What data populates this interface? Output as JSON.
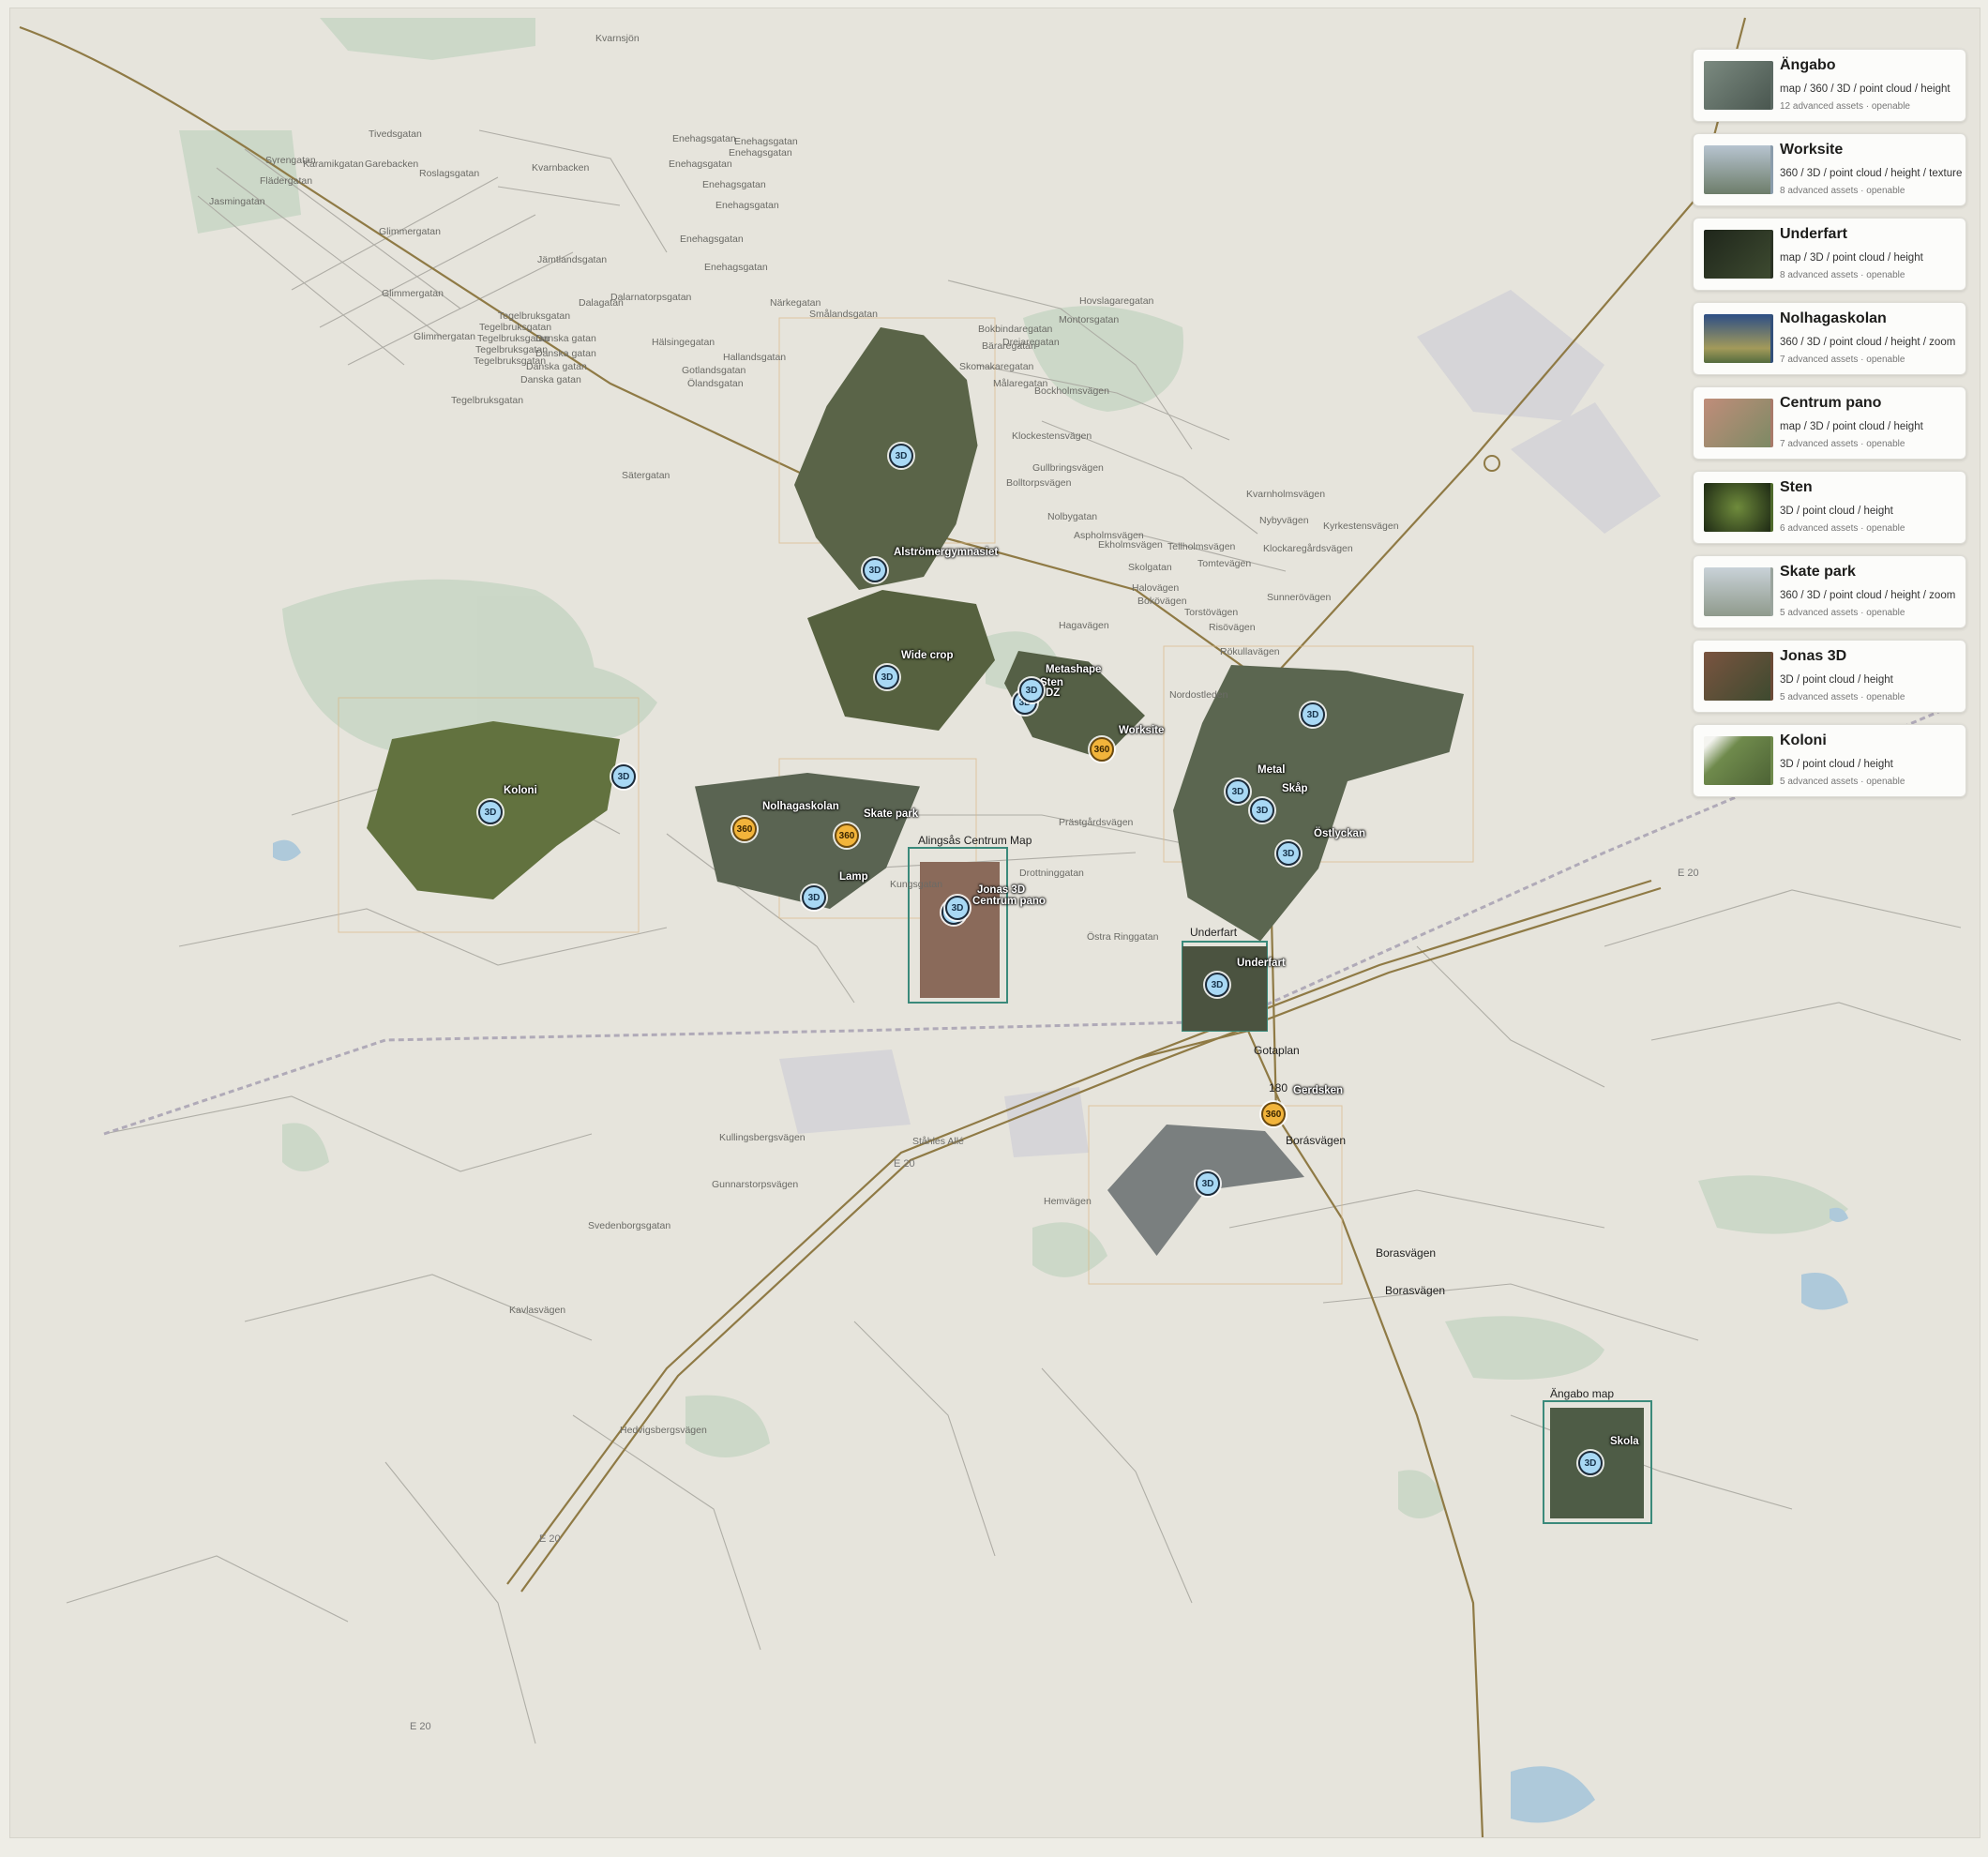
{
  "map": {
    "place_labels": [
      "Kvarnsjön",
      "Tivedsgatan",
      "Syrengatan",
      "Karamikgatan",
      "Garebacken",
      "Flädergatan",
      "Jasmingatan",
      "Glimmergatan",
      "Roslagsgatan",
      "Kvarnbacken",
      "Enehagsgatan",
      "Enehagsgatan",
      "Enehagsgatan",
      "Enehagsgatan",
      "Enehagsgatan",
      "Enehagsgatan",
      "Enehagsgatan",
      "Enehagsgatan",
      "Jämtlandsgatan",
      "Dalagatan",
      "Dalarnatorpsgatan",
      "Närkegatan",
      "Smålandsgatan",
      "Hallandsgatan",
      "Gotlandsgatan",
      "Ölandsgatan",
      "Hälsingegatan",
      "Tegelbruksgatan",
      "Tegelbruksgatan",
      "Tegelbruksgatan",
      "Tegelbruksgatan",
      "Tegelbruksgatan",
      "Tegelbruksgatan",
      "Danska gatan",
      "Danska gatan",
      "Danska gatan",
      "Danska gatan",
      "Glimmergatan",
      "Glimmergatan",
      "Sätergatan",
      "Hovslagaregatan",
      "Montorsgatan",
      "Bokbindaregatan",
      "Drejaregatan",
      "Bäraregatan",
      "Skomakaregatan",
      "Målaregatan",
      "Bockholmsvägen",
      "Klockestensvägen",
      "Gullbringsvägen",
      "Bolltorpsvägen",
      "Nolbygatan",
      "Aspholmsvägen",
      "Ekholmsvägen",
      "Tellholmsvägen",
      "Kvarnholmsvägen",
      "Nybyvägen",
      "Kyrkestensvägen",
      "Klockaregårdsvägen",
      "Skolgatan",
      "Tomtevägen",
      "Halovägen",
      "Bokövägen",
      "Sunnerövägen",
      "Torstövägen",
      "Risövägen",
      "Rökullavägen",
      "Nordostleden",
      "Hagavägen",
      "Prästgårdsvägen",
      "Drottninggatan",
      "Östra Ringgatan",
      "Kungsgatan",
      "Underfart",
      "Gotaplan",
      "180",
      "Borásvägen",
      "Borasvägen",
      "Borasvägen",
      "Kullingsbergsvägen",
      "Gunnarstorpsvägen",
      "Svedenborgsgatan",
      "Ståhles Allé",
      "Hemvägen",
      "Kavlasvägen",
      "Hedvigsbergsvägen",
      "E 20",
      "E 20",
      "E 20",
      "E 20",
      "Ängabo map",
      "Alingsås Centrum Map"
    ],
    "project_labels": [
      "Alströmergymnasiet",
      "Wide crop",
      "Metashape",
      "Sten",
      "DZ",
      "Worksite",
      "Koloni",
      "Nolhagaskolan",
      "Skate park",
      "Lamp",
      "Jonas 3D",
      "Centrum pano",
      "Metal",
      "Skåp",
      "Östlyckan",
      "Underfart",
      "Gerdsken",
      "Skola"
    ],
    "markers": [
      {
        "label": "3D",
        "kind": "3d"
      },
      {
        "label": "3D",
        "kind": "3d"
      },
      {
        "label": "3D",
        "kind": "3d"
      },
      {
        "label": "3D",
        "kind": "3d"
      },
      {
        "label": "3D",
        "kind": "3d"
      },
      {
        "label": "3D",
        "kind": "3d"
      },
      {
        "label": "360",
        "kind": "360"
      },
      {
        "label": "3D",
        "kind": "3d"
      },
      {
        "label": "3D",
        "kind": "3d"
      },
      {
        "label": "360",
        "kind": "360"
      },
      {
        "label": "360",
        "kind": "360"
      },
      {
        "label": "3D",
        "kind": "3d"
      },
      {
        "label": "3D",
        "kind": "3d"
      },
      {
        "label": "3D",
        "kind": "3d"
      },
      {
        "label": "3D",
        "kind": "3d"
      },
      {
        "label": "3D",
        "kind": "3d"
      },
      {
        "label": "3D",
        "kind": "3d"
      },
      {
        "label": "3D",
        "kind": "3d"
      },
      {
        "label": "360",
        "kind": "360"
      },
      {
        "label": "3D",
        "kind": "3d"
      },
      {
        "label": "3D",
        "kind": "3d"
      }
    ],
    "colors": {
      "background": "#e6e4dc",
      "green": "#c9d6c5",
      "water": "#aec9da",
      "major_road": "#8f7a45",
      "minor_road": "#a9a7a0",
      "marker_3d": "#a8d8f4",
      "marker_360": "#f2b43b"
    }
  },
  "projects": [
    {
      "title": "Ängabo",
      "types": "map / 360 / 3D / point cloud / height",
      "meta": "12 advanced assets · openable",
      "thumb_color": "#5c6a63"
    },
    {
      "title": "Worksite",
      "types": "360 / 3D / point cloud / height / texture",
      "meta": "8 advanced assets · openable",
      "thumb_color": "#8a9cab"
    },
    {
      "title": "Underfart",
      "types": "map / 3D / point cloud / height",
      "meta": "8 advanced assets · openable",
      "thumb_color": "#2b3324"
    },
    {
      "title": "Nolhagaskolan",
      "types": "360 / 3D / point cloud / height / zoom",
      "meta": "7 advanced assets · openable",
      "thumb_color": "#32507a"
    },
    {
      "title": "Centrum pano",
      "types": "map / 3D / point cloud / height",
      "meta": "7 advanced assets · openable",
      "thumb_color": "#a87a6a"
    },
    {
      "title": "Sten",
      "types": "3D / point cloud / height",
      "meta": "6 advanced assets · openable",
      "thumb_color": "#4f6a2c"
    },
    {
      "title": "Skate park",
      "types": "360 / 3D / point cloud / height / zoom",
      "meta": "5 advanced assets · openable",
      "thumb_color": "#9aa49d"
    },
    {
      "title": "Jonas 3D",
      "types": "3D / point cloud / height",
      "meta": "5 advanced assets · openable",
      "thumb_color": "#6b4a36"
    },
    {
      "title": "Koloni",
      "types": "3D / point cloud / height",
      "meta": "5 advanced assets · openable",
      "thumb_color": "#6f8a4c"
    }
  ]
}
